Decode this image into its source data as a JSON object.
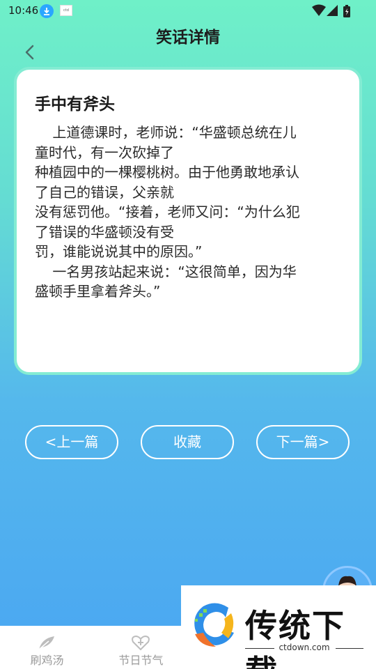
{
  "status_bar": {
    "time": "10:46",
    "small_app_text": "ctd"
  },
  "page_title": "笑话详情",
  "joke": {
    "title": "手中有斧头",
    "lines": [
      "    上道德课时，老师说：“华盛顿总统在儿",
      "童时代，有一次砍掉了",
      "种植园中的一棵樱桃树。由于他勇敢地承认",
      "了自己的错误，父亲就",
      "没有惩罚他。“接着，老师又问：“为什么犯",
      "了错误的华盛顿没有受",
      "罚，谁能说说其中的原因。”",
      "    一名男孩站起来说：“这很简单，因为华",
      "盛顿手里拿着斧头。”"
    ]
  },
  "buttons": {
    "prev": "<上一篇",
    "favorite": "收藏",
    "next": "下一篇>"
  },
  "tabs": [
    {
      "label": "刷鸡汤",
      "icon": "feather-icon"
    },
    {
      "label": "节日节气",
      "icon": "heart-plus-icon"
    }
  ],
  "watermark": {
    "text": "传统下载",
    "url": "ctdown.com"
  },
  "colors": {
    "gradient_top": "#6ff0c8",
    "gradient_bottom": "#4aa6f2",
    "card_border": "#84ecd3"
  }
}
